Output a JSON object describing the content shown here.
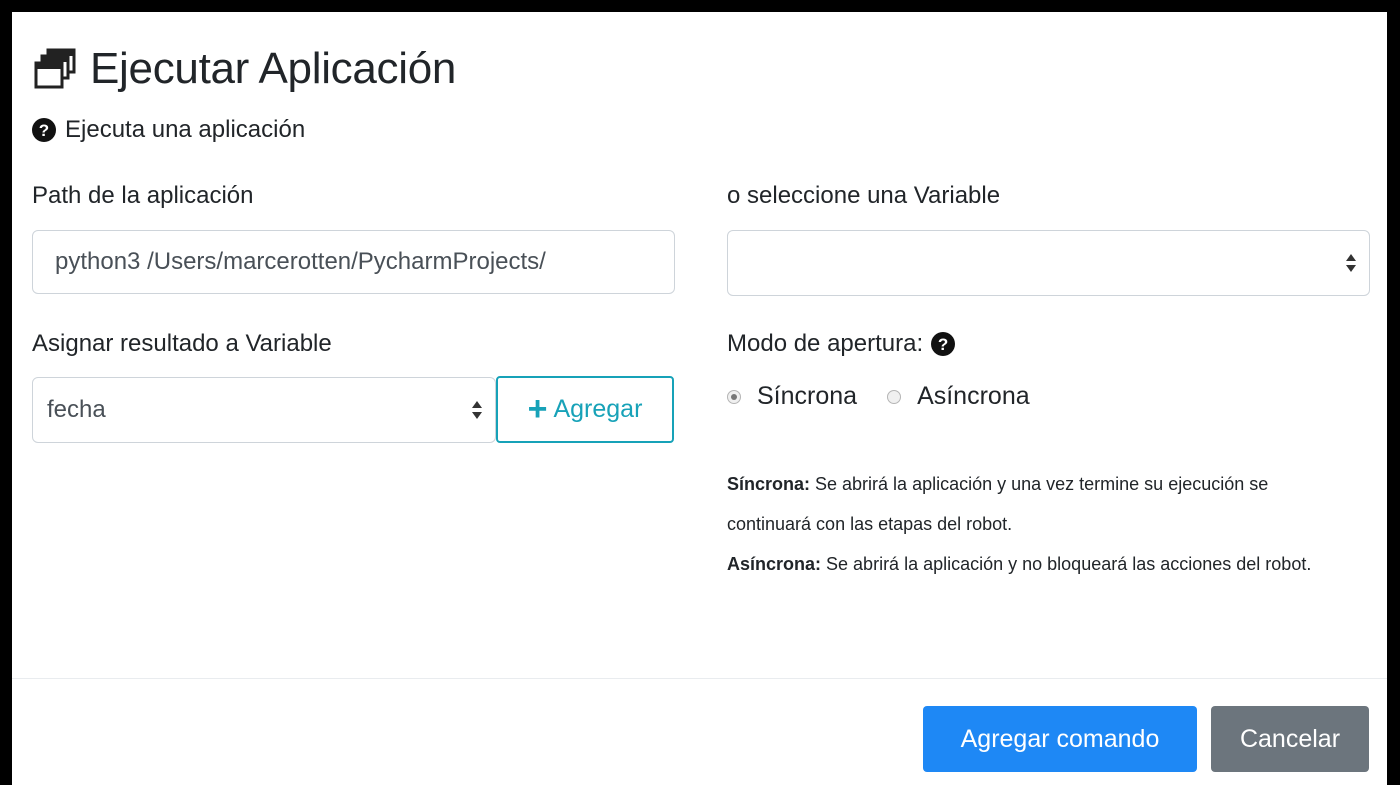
{
  "modal": {
    "title": "Ejecutar Aplicación",
    "title_icon": "window-restore-icon",
    "help_text": "Ejecuta una aplicación",
    "help_icon": "question-circle-icon"
  },
  "form": {
    "path_label": "Path de la aplicación",
    "path_value": "python3 /Users/marcerotten/PycharmProjects/",
    "variable_label": "o seleccione una Variable",
    "variable_value": "",
    "result_label": "Asignar resultado a Variable",
    "result_value": "fecha",
    "add_button_label": "Agregar",
    "add_button_icon": "plus-icon",
    "mode_label": "Modo de apertura:",
    "modes": [
      {
        "label": "Síncrona",
        "checked": true
      },
      {
        "label": "Asíncrona",
        "checked": false
      }
    ],
    "description": {
      "sync_title": "Síncrona:",
      "sync_text": " Se abrirá la aplicación y una vez termine su ejecución se continuará con las etapas del robot.",
      "async_title": "Asíncrona:",
      "async_text": " Se abrirá la aplicación y no bloqueará las acciones del robot."
    }
  },
  "footer": {
    "primary_label": "Agregar comando",
    "secondary_label": "Cancelar"
  },
  "colors": {
    "primary": "#1e88f5",
    "secondary": "#6c757d",
    "info": "#17a2b8"
  }
}
